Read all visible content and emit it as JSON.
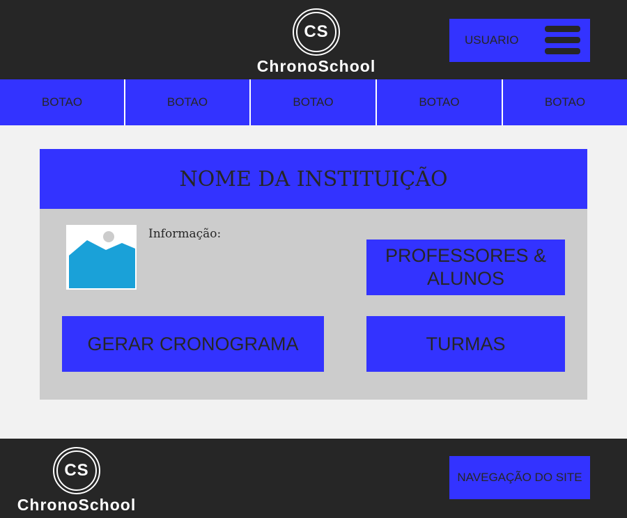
{
  "brand": {
    "logo_initials": "CS",
    "name": "ChronoSchool"
  },
  "header": {
    "user_label": "USUARIO"
  },
  "nav": {
    "buttons": [
      "BOTAO",
      "BOTAO",
      "BOTAO",
      "BOTAO",
      "BOTAO"
    ]
  },
  "card": {
    "title": "NOME DA INSTITUIÇÃO",
    "info_label": "Informação:",
    "buttons": {
      "professores_line1": "PROFESSORES &",
      "professores_line2": "ALUNOS",
      "gerar": "GERAR CRONOGRAMA",
      "turmas": "TURMAS"
    }
  },
  "footer": {
    "nav_label": "NAVEGAÇÃO DO SITE"
  },
  "colors": {
    "dark": "#262626",
    "accent": "#3333ff",
    "card": "#cccccc",
    "page": "#f2f2f2"
  }
}
